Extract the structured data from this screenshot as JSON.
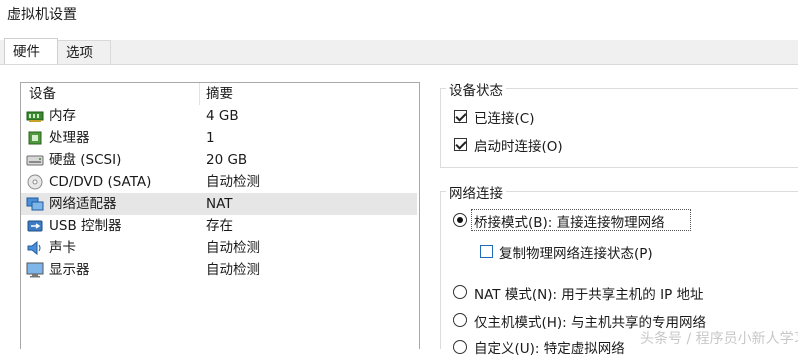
{
  "window": {
    "title": "虚拟机设置"
  },
  "tabs": [
    {
      "label": "硬件",
      "active": true
    },
    {
      "label": "选项",
      "active": false
    }
  ],
  "device_list": {
    "columns": [
      "设备",
      "摘要"
    ],
    "rows": [
      {
        "icon": "memory-icon",
        "device": "内存",
        "summary": "4 GB"
      },
      {
        "icon": "processor-icon",
        "device": "处理器",
        "summary": "1"
      },
      {
        "icon": "hard-disk-icon",
        "device": "硬盘 (SCSI)",
        "summary": "20 GB"
      },
      {
        "icon": "cd-dvd-icon",
        "device": "CD/DVD (SATA)",
        "summary": "自动检测"
      },
      {
        "icon": "network-adapter-icon",
        "device": "网络适配器",
        "summary": "NAT",
        "selected": true
      },
      {
        "icon": "usb-icon",
        "device": "USB 控制器",
        "summary": "存在"
      },
      {
        "icon": "sound-card-icon",
        "device": "声卡",
        "summary": "自动检测"
      },
      {
        "icon": "display-icon",
        "device": "显示器",
        "summary": "自动检测"
      }
    ]
  },
  "device_status": {
    "title": "设备状态",
    "connected_label": "已连接(C)",
    "connect_at_power_on_label": "启动时连接(O)"
  },
  "network_connection": {
    "title": "网络连接",
    "bridged_label": "桥接模式(B): 直接连接物理网络",
    "replicate_state_label": "复制物理网络连接状态(P)",
    "nat_label": "NAT 模式(N): 用于共享主机的 IP 地址",
    "host_only_label": "仅主机模式(H): 与主机共享的专用网络",
    "custom_label": "自定义(U): 特定虚拟网络"
  },
  "watermark": "头条号 / 程序员小新人学习",
  "colors": {
    "selected_row": "#e6e6e6",
    "tab_strip": "#f0f0f0",
    "accent_checkbox": "#1e6bb8"
  }
}
